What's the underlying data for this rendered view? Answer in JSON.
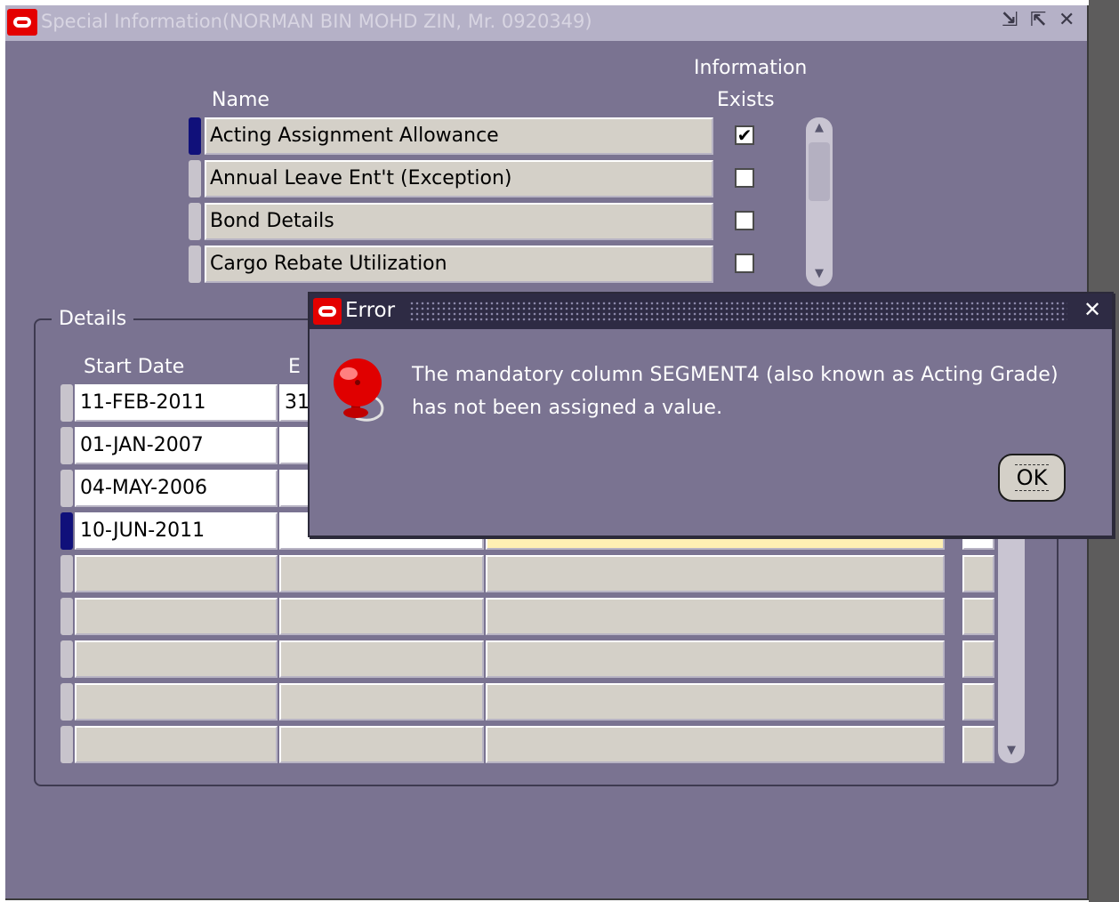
{
  "window": {
    "title": "Special Information(NORMAN BIN MOHD ZIN, Mr. 0920349)",
    "minimize_glyph": "⇲",
    "maximize_glyph": "⇱",
    "close_glyph": "✕"
  },
  "special_info": {
    "header_name": "Name",
    "header_info_line1": "Information",
    "header_info_line2": "Exists",
    "rows": [
      {
        "name": "Acting Assignment Allowance",
        "exists": true
      },
      {
        "name": "Annual Leave Ent't (Exception)",
        "exists": false
      },
      {
        "name": "Bond Details",
        "exists": false
      },
      {
        "name": "Cargo Rebate Utilization",
        "exists": false
      }
    ]
  },
  "details": {
    "legend": "Details",
    "header_start": "Start Date",
    "header_end_partial": "E",
    "rows": [
      {
        "start": "11-FEB-2011",
        "end": "31"
      },
      {
        "start": "01-JAN-2007",
        "end": ""
      },
      {
        "start": "04-MAY-2006",
        "end": ""
      },
      {
        "start": "10-JUN-2011",
        "end": ""
      }
    ]
  },
  "error_dialog": {
    "title": "Error",
    "close_glyph": "✕",
    "message_line1": "The mandatory column SEGMENT4 (also known as Acting Grade)",
    "message_line2": "has not been assigned a value.",
    "ok_label": "OK",
    "icon": "alarm-bell-icon"
  },
  "colors": {
    "window_bg": "#7a7391",
    "titlebar_bg": "#b5b1c7",
    "dialog_titlebar_bg": "#2e2b44",
    "current_row_indicator": "#10107a",
    "highlight_field": "#fff0b3"
  }
}
